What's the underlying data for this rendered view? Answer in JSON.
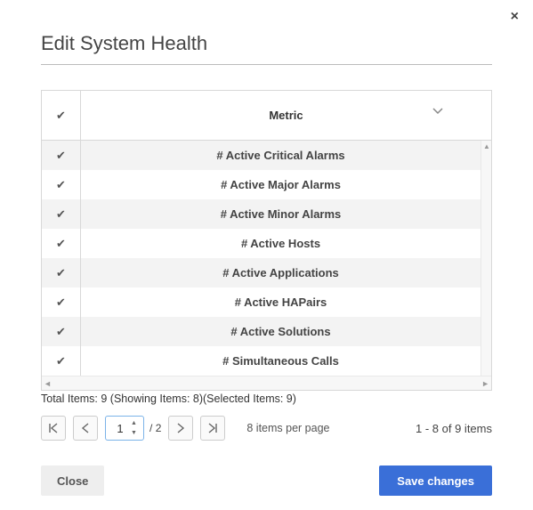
{
  "close_x": "×",
  "title": "Edit System Health",
  "header": {
    "metric": "Metric"
  },
  "rows": [
    {
      "label": "# Active Critical Alarms"
    },
    {
      "label": "# Active Major Alarms"
    },
    {
      "label": "# Active Minor Alarms"
    },
    {
      "label": "# Active Hosts"
    },
    {
      "label": "# Active Applications"
    },
    {
      "label": "# Active HAPairs"
    },
    {
      "label": "# Active Solutions"
    },
    {
      "label": "# Simultaneous Calls"
    }
  ],
  "status": "Total Items: 9 (Showing Items: 8)(Selected Items: 9)",
  "pager": {
    "page": "1",
    "total_pages": "2",
    "slash": "/",
    "per_page": "8 items per page",
    "range": "1 - 8 of 9 items"
  },
  "footer": {
    "close": "Close",
    "save": "Save changes"
  }
}
